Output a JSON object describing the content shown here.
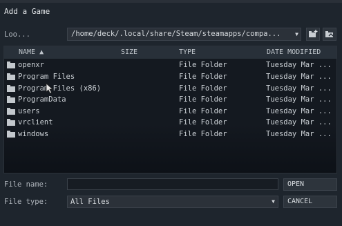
{
  "window": {
    "title": "Add a Game"
  },
  "look_in": {
    "label": "Loo...",
    "path": "/home/deck/.local/share/Steam/steamapps/compa...",
    "arrow": "▼"
  },
  "toolbar": {
    "new_folder_icon": "new-folder-icon",
    "up_folder_icon": "parent-folder-icon"
  },
  "columns": {
    "name": "NAME ▲",
    "size": "SIZE",
    "type": "TYPE",
    "date": "DATE MODIFIED"
  },
  "rows": [
    {
      "name": "openxr",
      "type": "File Folder",
      "date": "Tuesday Mar ..."
    },
    {
      "name": "Program Files",
      "type": "File Folder",
      "date": "Tuesday Mar ..."
    },
    {
      "name": "Program Files (x86)",
      "type": "File Folder",
      "date": "Tuesday Mar ..."
    },
    {
      "name": "ProgramData",
      "type": "File Folder",
      "date": "Tuesday Mar ..."
    },
    {
      "name": "users",
      "type": "File Folder",
      "date": "Tuesday Mar ..."
    },
    {
      "name": "vrclient",
      "type": "File Folder",
      "date": "Tuesday Mar ..."
    },
    {
      "name": "windows",
      "type": "File Folder",
      "date": "Tuesday Mar ..."
    }
  ],
  "file_name": {
    "label": "File name:",
    "value": ""
  },
  "file_type": {
    "label": "File type:",
    "value": "All Files",
    "arrow": "▼"
  },
  "buttons": {
    "open": "OPEN",
    "cancel": "CANCEL"
  }
}
